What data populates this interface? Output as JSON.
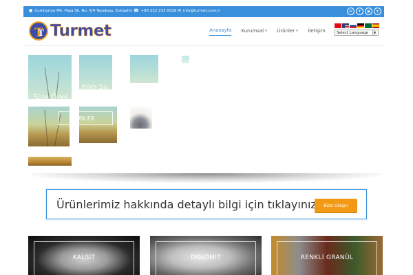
{
  "topbar": {
    "address": "Cumhuriye Mh. Paşa Sk. No: 5/4 Tepebaşı, Eskişehir",
    "phone": "+90 222 233 0026",
    "email": "info@turmet.com.tr",
    "social": [
      "email-icon",
      "facebook-icon",
      "instagram-icon",
      "twitter-icon"
    ]
  },
  "logo": {
    "text": "Turmet"
  },
  "nav": {
    "items": [
      {
        "label": "Anasayfa",
        "active": true,
        "dropdown": false
      },
      {
        "label": "Kurumsal",
        "active": false,
        "dropdown": true
      },
      {
        "label": "Ürünler",
        "active": false,
        "dropdown": true
      },
      {
        "label": "İletişim",
        "active": false,
        "dropdown": false
      }
    ]
  },
  "language": {
    "select_label": "Select Language",
    "flags": [
      "tr",
      "us",
      "ru",
      "de",
      "sa",
      "es"
    ]
  },
  "slider": {
    "text_line1": "Size Özel",
    "text_line1b": "mler Su",
    "button_label": "ÜNLER"
  },
  "cta": {
    "text": "Ürünlerimiz hakkında detaylı bilgi için tıklayınız",
    "button_label": "Bize Ulaşın"
  },
  "products": [
    {
      "label": "KALSİT"
    },
    {
      "label": "DOLOMİT"
    },
    {
      "label": "RENKLİ GRANÜL"
    }
  ],
  "colors": {
    "primary": "#3a8fdc",
    "accent": "#f29a16"
  }
}
